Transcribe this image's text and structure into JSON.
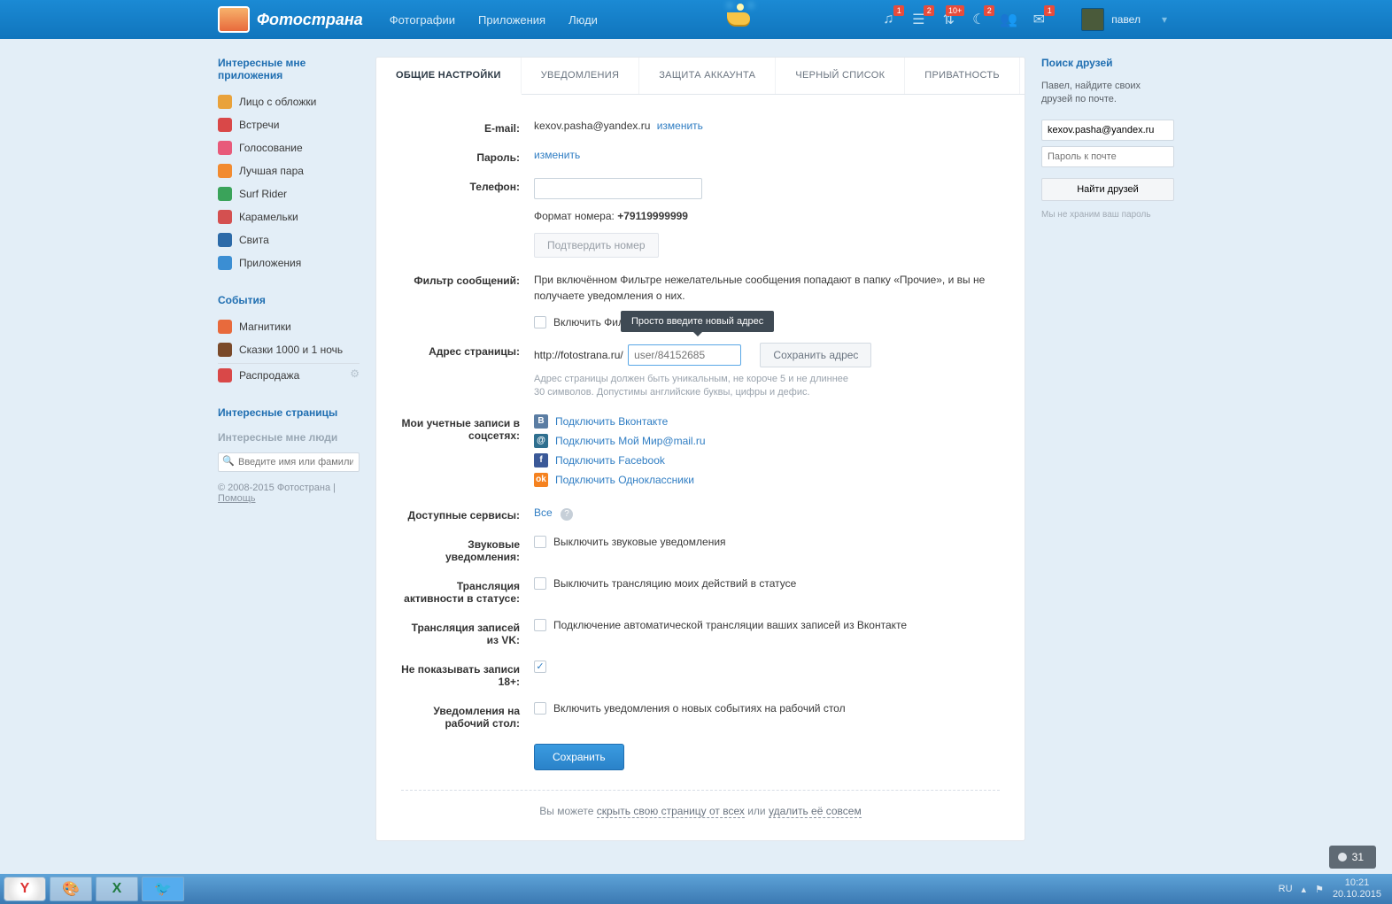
{
  "header": {
    "brand": "Фотострана",
    "nav": {
      "photos": "Фотографии",
      "apps": "Приложения",
      "people": "Люди"
    },
    "badges": {
      "music": "1",
      "notes": "2",
      "updates": "10+",
      "moon": "2",
      "mail": "1"
    },
    "user": {
      "name": "павел"
    }
  },
  "sidebar": {
    "apps_title": "Интересные мне приложения",
    "apps": [
      {
        "label": "Лицо с обложки"
      },
      {
        "label": "Встречи"
      },
      {
        "label": "Голосование"
      },
      {
        "label": "Лучшая пара"
      },
      {
        "label": "Surf Rider"
      },
      {
        "label": "Карамельки"
      },
      {
        "label": "Свита"
      },
      {
        "label": "Приложения"
      }
    ],
    "events_title": "События",
    "events": [
      {
        "label": "Магнитики"
      },
      {
        "label": "Сказки 1000 и 1 ночь"
      },
      {
        "label": "Распродажа"
      }
    ],
    "pages_title": "Интересные страницы",
    "people_title": "Интересные мне люди",
    "search_placeholder": "Введите имя или фамилию",
    "footer_copy": "© 2008-2015 Фотострана",
    "footer_help": "Помощь"
  },
  "tabs": {
    "general": "ОБЩИЕ НАСТРОЙКИ",
    "notif": "УВЕДОМЛЕНИЯ",
    "security": "ЗАЩИТА АККАУНТА",
    "blacklist": "ЧЕРНЫЙ СПИСОК",
    "privacy": "ПРИВАТНОСТЬ"
  },
  "form": {
    "email_label": "E-mail:",
    "email_value": "kexov.pasha@yandex.ru",
    "email_change": "изменить",
    "password_label": "Пароль:",
    "password_change": "изменить",
    "phone_label": "Телефон:",
    "phone_format_label": "Формат номера:",
    "phone_format_value": "+79119999999",
    "phone_confirm": "Подтвердить номер",
    "filter_label": "Фильтр сообщений:",
    "filter_text": "При включённом Фильтре нежелательные сообщения попадают в папку «Прочие», и вы не получаете уведомления о них.",
    "filter_cb": "Включить Фил",
    "url_label": "Адрес страницы:",
    "url_prefix": "http://fotostrana.ru/",
    "url_placeholder": "user/84152685",
    "url_save": "Сохранить адрес",
    "url_tooltip": "Просто введите новый адрес",
    "url_hint1": "Адрес страницы должен быть уникальным, не короче 5 и не длиннее",
    "url_hint2": "30 символов. Допустимы английские буквы, цифры и дефис.",
    "socials_label": "Мои учетные записи в соцсетях:",
    "social_vk": "Подключить Вконтакте",
    "social_mm": "Подключить Мой Мир@mail.ru",
    "social_fb": "Подключить Facebook",
    "social_ok": "Подключить Одноклассники",
    "services_label": "Доступные сервисы:",
    "services_value": "Все",
    "sound_label": "Звуковые уведомления:",
    "sound_cb": "Выключить звуковые уведомления",
    "status_label": "Трансляция активности в статусе:",
    "status_cb": "Выключить трансляцию моих действий в статусе",
    "vk_label": "Трансляция записей из VK:",
    "vk_cb": "Подключение автоматической трансляции ваших записей из Вконтакте",
    "adult_label": "Не показывать записи 18+:",
    "desktop_label": "Уведомления на рабочий стол:",
    "desktop_cb": "Включить уведомления о новых событиях на рабочий стол",
    "save_btn": "Сохранить",
    "bottom_pre": "Вы можете ",
    "bottom_link1": "скрыть свою страницу от всех",
    "bottom_mid": " или ",
    "bottom_link2": "удалить её совсем"
  },
  "right": {
    "title": "Поиск друзей",
    "note": "Павел, найдите своих друзей по почте.",
    "email_value": "kexov.pasha@yandex.ru",
    "pwd_placeholder": "Пароль к почте",
    "btn_label": "Найти друзей",
    "sub": "Мы не храним ваш пароль"
  },
  "taskbar": {
    "lang": "RU",
    "time": "10:21",
    "date": "20.10.2015",
    "pill_count": "31"
  }
}
